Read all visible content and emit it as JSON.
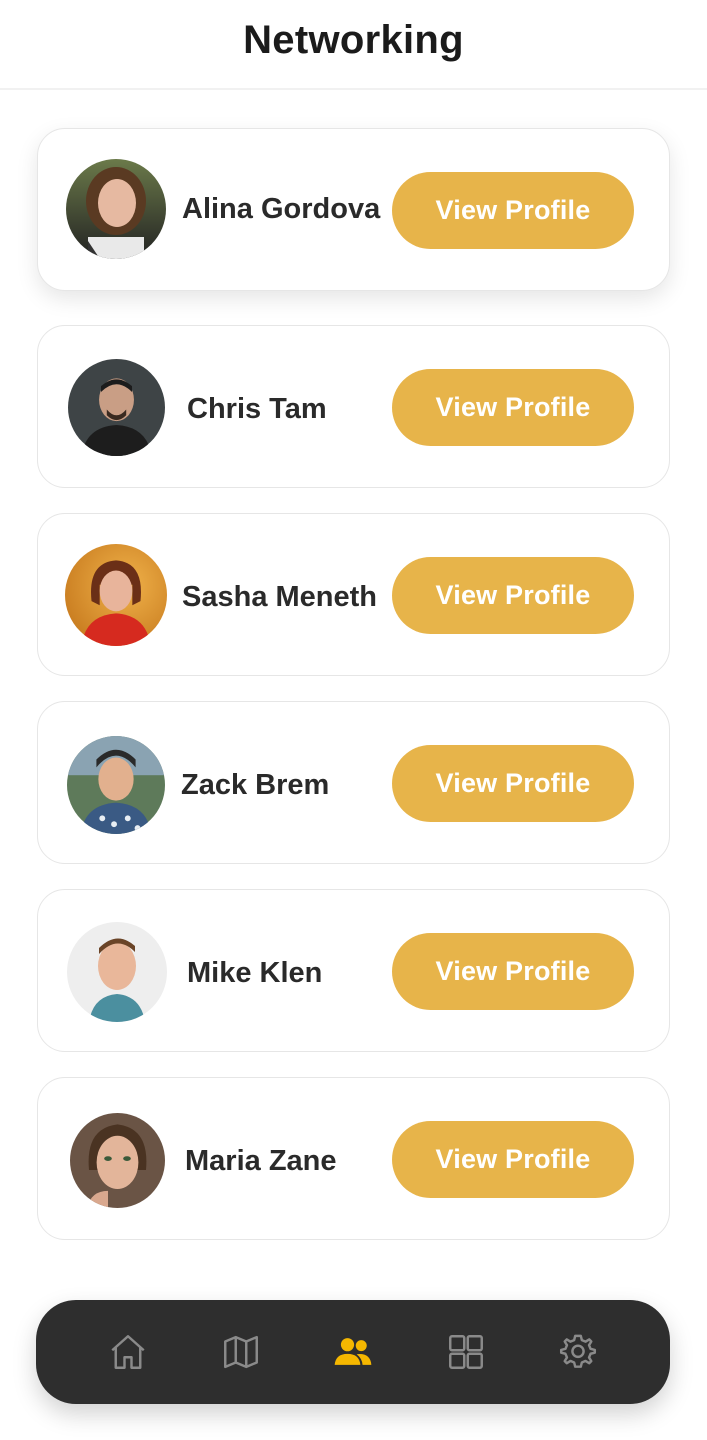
{
  "header": {
    "title": "Networking"
  },
  "contacts": [
    {
      "name": "Alina Gordova",
      "button": "View Profile"
    },
    {
      "name": "Chris Tam",
      "button": "View Profile"
    },
    {
      "name": "Sasha Meneth",
      "button": "View Profile"
    },
    {
      "name": "Zack Brem",
      "button": "View Profile"
    },
    {
      "name": "Mike Klen",
      "button": "View Profile"
    },
    {
      "name": "Maria Zane",
      "button": "View Profile"
    }
  ],
  "bottom_nav": {
    "items": [
      {
        "icon": "home-icon",
        "active": false
      },
      {
        "icon": "map-icon",
        "active": false
      },
      {
        "icon": "people-icon",
        "active": true
      },
      {
        "icon": "grid-icon",
        "active": false
      },
      {
        "icon": "settings-icon",
        "active": false
      }
    ]
  },
  "colors": {
    "accent": "#e7b44a",
    "nav_background": "#2e2e2e",
    "nav_active": "#f5b700",
    "nav_inactive": "#8a8a8a"
  }
}
